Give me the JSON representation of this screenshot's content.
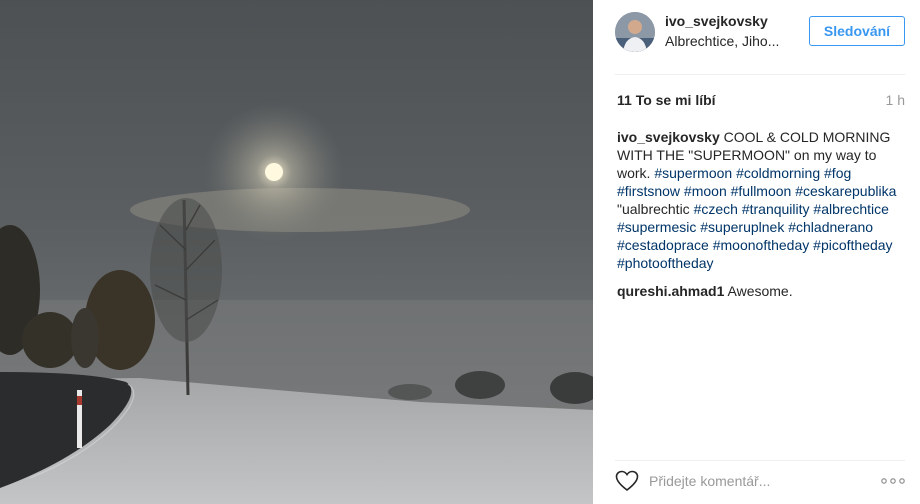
{
  "post": {
    "username": "ivo_svejkovsky",
    "location": "Albrechtice, Jiho...",
    "follow_label": "Sledování",
    "likes": "11 To se mi líbí",
    "time_ago": "1 h"
  },
  "caption": {
    "username": "ivo_svejkovsky",
    "text": "COOL & COLD MORNING WITH THE \"SUPERMOON\" on my way to work.",
    "tags": [
      "#supermoon",
      "#coldmorning",
      "#fog",
      "#firstsnow",
      "#moon",
      "#fullmoon",
      "#ceskarepublika"
    ],
    "tail_text": "\"ualbrechtic",
    "tags2": [
      "#czech",
      "#tranquility",
      "#albrechtice",
      "#supermesic",
      "#superuplnek",
      "#chladnerano",
      "#cestadoprace",
      "#moonoftheday",
      "#picoftheday",
      "#photooftheday"
    ]
  },
  "comment": {
    "username": "qureshi.ahmad1",
    "text": "Awesome."
  },
  "footer": {
    "comment_placeholder": "Přidejte komentář...",
    "like_icon": "heart-outline-icon",
    "more_icon": "more-dots-icon"
  }
}
